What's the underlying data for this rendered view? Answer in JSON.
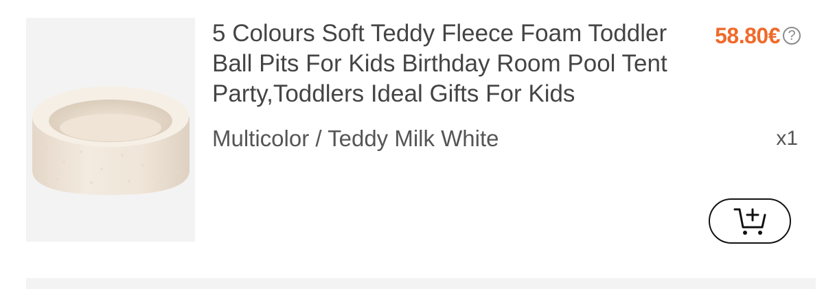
{
  "product": {
    "title": "5 Colours Soft Teddy Fleece Foam Toddler Ball Pits For Kids Birthday Room Pool Tent Party,Toddlers Ideal Gifts For Kids",
    "price": "58.80€",
    "price_help_icon": "question-circle-icon",
    "variant": "Multicolor / Teddy Milk White",
    "quantity": "x1",
    "image": "teddy-fleece-ball-pit",
    "add_to_cart_icon": "cart-plus-icon"
  },
  "colors": {
    "price": "#f06a2a",
    "text": "#444444",
    "thumbnail_bg": "#f3f3f3"
  }
}
